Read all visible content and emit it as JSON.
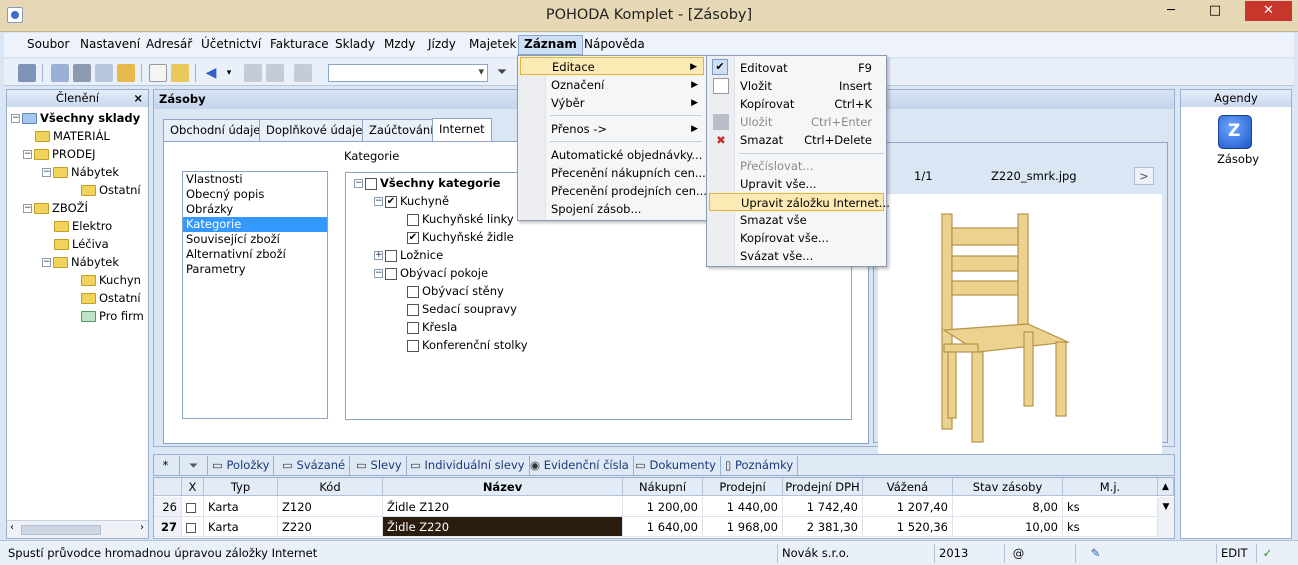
{
  "window": {
    "title": "POHODA Komplet - [Zásoby]",
    "minimize": "─",
    "maximize": "□",
    "close": "✕"
  },
  "menubar": [
    "Soubor",
    "Nastavení",
    "Adresář",
    "Účetnictví",
    "Fakturace",
    "Sklady",
    "Mzdy",
    "Jízdy",
    "Majetek",
    "Záznam",
    "Nápověda"
  ],
  "left_panel": {
    "title": "Členění",
    "close": "×",
    "tree": [
      {
        "label": "Všechny sklady",
        "bold": true
      },
      {
        "label": "MATERIÁL"
      },
      {
        "label": "PRODEJ"
      },
      {
        "label": "Nábytek"
      },
      {
        "label": "Ostatní"
      },
      {
        "label": "ZBOŽÍ"
      },
      {
        "label": "Elektro"
      },
      {
        "label": "Léčiva"
      },
      {
        "label": "Nábytek"
      },
      {
        "label": "Kuchyn"
      },
      {
        "label": "Ostatní"
      },
      {
        "label": "Pro firm"
      }
    ]
  },
  "main": {
    "title": "Zásoby",
    "tabs": [
      "Obchodní údaje",
      "Doplňkové údaje",
      "Zaúčtování",
      "Internet"
    ],
    "active_tab": "Internet",
    "properties": [
      "Vlastnosti",
      "Obecný popis",
      "Obrázky",
      "Kategorie",
      "Související zboží",
      "Alternativní zboží",
      "Parametry"
    ],
    "selected_property": "Kategorie",
    "category_label": "Kategorie",
    "categories": [
      {
        "label": "Všechny kategorie",
        "checked": false,
        "bold": true
      },
      {
        "label": "Kuchyně",
        "checked": true
      },
      {
        "label": "Kuchyňské linky",
        "checked": false
      },
      {
        "label": "Kuchyňské židle",
        "checked": true
      },
      {
        "label": "Ložnice",
        "checked": false
      },
      {
        "label": "Obývací pokoje",
        "checked": false
      },
      {
        "label": "Obývací stěny",
        "checked": false
      },
      {
        "label": "Sedací soupravy",
        "checked": false
      },
      {
        "label": "Křesla",
        "checked": false
      },
      {
        "label": "Konferenční stolky",
        "checked": false
      }
    ],
    "image": {
      "counter": "1/1",
      "filename": "Z220_smrk.jpg",
      "prev": "<",
      "next": ">"
    }
  },
  "agenda": {
    "title": "Agendy",
    "item": "Zásoby"
  },
  "bottom_tabs": [
    "Položky",
    "Svázané",
    "Slevy",
    "Individuální slevy",
    "Evidenční čísla",
    "Dokumenty",
    "Poznámky"
  ],
  "grid": {
    "columns": [
      "X",
      "Typ",
      "Kód",
      "Název",
      "Nákupní",
      "Prodejní",
      "Prodejní DPH",
      "Vážená",
      "Stav zásoby",
      "M.j."
    ],
    "rows": [
      {
        "num": "26",
        "typ": "Karta",
        "kod": "Z120",
        "nazev": "Židle Z120",
        "nakupni": "1 200,00",
        "prodejni": "1 440,00",
        "dph": "1 742,40",
        "vazena": "1 207,40",
        "stav": "8,00",
        "mj": "ks"
      },
      {
        "num": "27",
        "typ": "Karta",
        "kod": "Z220",
        "nazev": "Židle Z220",
        "nakupni": "1 640,00",
        "prodejni": "1 968,00",
        "dph": "2 381,30",
        "vazena": "1 520,36",
        "stav": "10,00",
        "mj": "ks"
      }
    ]
  },
  "status": {
    "message": "Spustí průvodce hromadnou úpravou záložky Internet",
    "company": "Novák  s.r.o.",
    "year": "2013",
    "mode": "EDIT",
    "at": "@"
  },
  "menu_zaznam": [
    {
      "label": "Editace",
      "submenu": true,
      "highlight": true
    },
    {
      "label": "Označení",
      "submenu": true
    },
    {
      "label": "Výběr",
      "submenu": true
    },
    {
      "label": "Přenos ->",
      "submenu": true
    },
    {
      "label": "Automatické objednávky..."
    },
    {
      "label": "Přecenění nákupních cen..."
    },
    {
      "label": "Přecenění prodejních cen..."
    },
    {
      "label": "Spojení zásob..."
    }
  ],
  "menu_editace": [
    {
      "label": "Editovat",
      "shortcut": "F9"
    },
    {
      "label": "Vložit",
      "shortcut": "Insert"
    },
    {
      "label": "Kopírovat",
      "shortcut": "Ctrl+K"
    },
    {
      "label": "Uložit",
      "shortcut": "Ctrl+Enter",
      "disabled": true
    },
    {
      "label": "Smazat",
      "shortcut": "Ctrl+Delete"
    },
    {
      "label": "Přečíslovat...",
      "disabled": true
    },
    {
      "label": "Upravit vše..."
    },
    {
      "label": "Upravit záložku Internet...",
      "highlight": true
    },
    {
      "label": "Smazat vše"
    },
    {
      "label": "Kopírovat vše..."
    },
    {
      "label": "Svázat vše..."
    }
  ]
}
